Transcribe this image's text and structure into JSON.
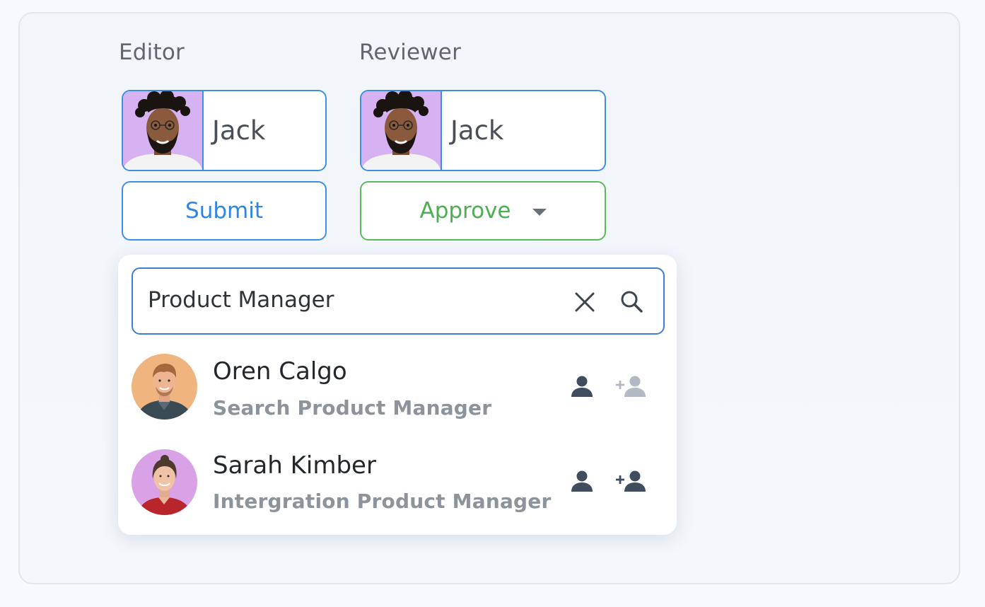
{
  "editor": {
    "label": "Editor",
    "assignee_name": "Jack",
    "button_label": "Submit"
  },
  "reviewer": {
    "label": "Reviewer",
    "assignee_name": "Jack",
    "button_label": "Approve"
  },
  "search": {
    "value": "Product Manager"
  },
  "results": [
    {
      "name": "Oren Calgo",
      "title": "Search Product Manager",
      "add_enabled": false
    },
    {
      "name": "Sarah Kimber",
      "title": "Intergration Product Manager",
      "add_enabled": true
    }
  ],
  "colors": {
    "primary_blue": "#3d8ee6",
    "approve_green": "#4caf50",
    "chip_photo_bg": "#d7b2f2",
    "icon_dark": "#3f4d5f",
    "icon_muted": "#b3b9c2"
  },
  "icons": {
    "clear": "close-icon",
    "search": "search-icon",
    "view_profile": "user-icon",
    "add_user": "add-user-icon",
    "dropdown": "chevron-down-icon"
  }
}
